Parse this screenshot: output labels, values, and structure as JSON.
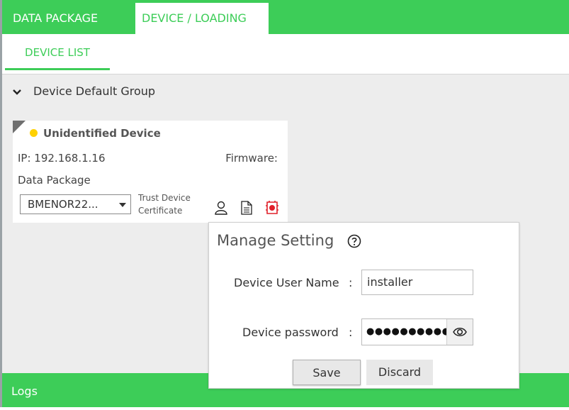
{
  "top_tabs": [
    {
      "label": "DATA PACKAGE"
    },
    {
      "label": "DEVICE / LOADING"
    }
  ],
  "subtabs": [
    {
      "label": "DEVICE LIST"
    }
  ],
  "group": {
    "label": "Device Default Group"
  },
  "device": {
    "name": "Unidentified Device",
    "status_color": "#ffd100",
    "ip": "IP: 192.168.1.16",
    "firmware": "Firmware:",
    "data_package_label": "Data Package",
    "data_package_value": "BMENOR22...",
    "trust_line1": "Trust Device",
    "trust_line2": "Certificate",
    "icons": [
      "user-icon",
      "document-icon",
      "certificate-icon"
    ]
  },
  "manage": {
    "title": "Manage Setting",
    "username_label": "Device User Name",
    "username_value": "installer",
    "password_label": "Device password",
    "password_mask": "●●●●●●●●●●",
    "colon": ":",
    "save_label": "Save",
    "discard_label": "Discard"
  },
  "logs": {
    "label": "Logs"
  },
  "colors": {
    "accent": "#3dcd58",
    "background": "#ededed"
  }
}
